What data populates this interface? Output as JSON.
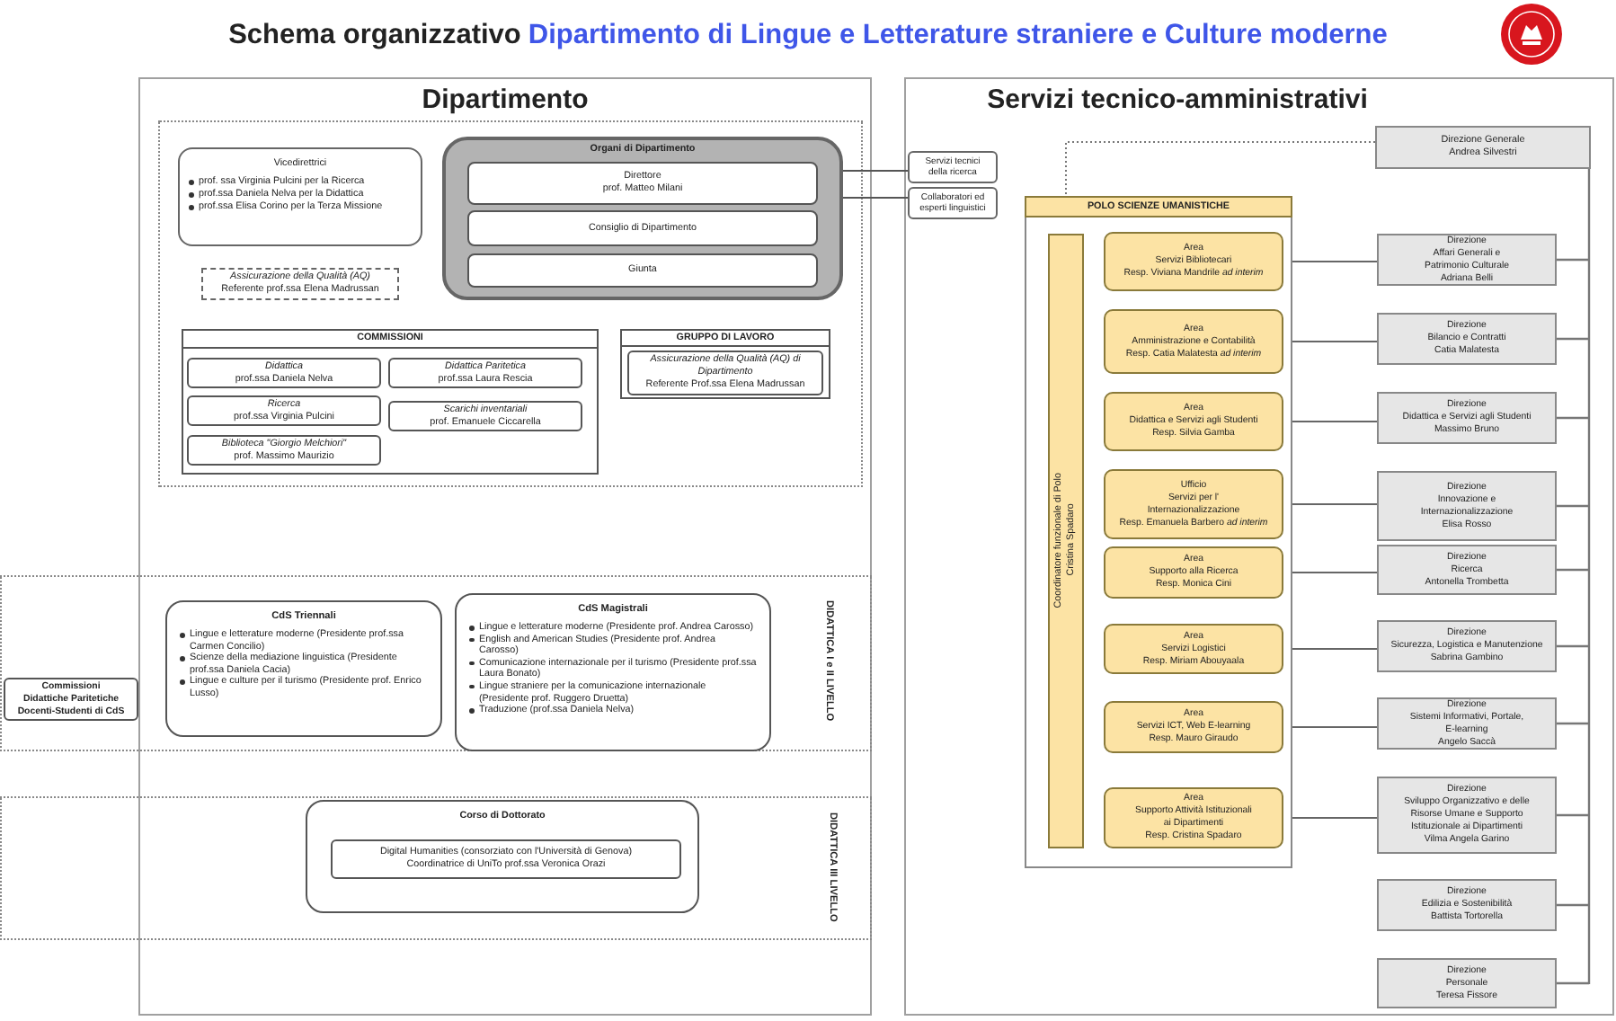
{
  "header": {
    "title": "Schema organizzativo",
    "department": "Dipartimento di Lingue e Letterature straniere e Culture moderne"
  },
  "department": {
    "title": "Dipartimento",
    "vice_directors": {
      "title": "Vicedirettrici",
      "items": [
        "prof. ssa Virginia Pulcini per la Ricerca",
        "prof.ssa Daniela Nelva per la Didattica",
        "prof.ssa Elisa Corino per la Terza Missione"
      ]
    },
    "quality": {
      "name": "Assicurazione della Qualità (AQ)",
      "person": "Referente prof.ssa Elena Madrussan"
    },
    "organs": {
      "title": "Organi di Dipartimento",
      "members": [
        {
          "lines": [
            "Direttore",
            "prof. Matteo Milani"
          ]
        },
        {
          "lines": [
            "Consiglio di Dipartimento"
          ]
        },
        {
          "lines": [
            "Giunta"
          ]
        }
      ]
    },
    "commissions": {
      "title": "COMMISSIONI",
      "items": [
        {
          "name": "Didattica",
          "person": "prof.ssa Daniela Nelva"
        },
        {
          "name": "Didattica Paritetica",
          "person": "prof.ssa Laura Rescia"
        },
        {
          "name": "Ricerca",
          "person": "prof.ssa Virginia Pulcini"
        },
        {
          "name": "Scarichi inventariali",
          "person": "prof. Emanuele Ciccarella"
        },
        {
          "name": "Biblioteca \"Giorgio Melchiori\"",
          "person": "prof. Massimo Maurizio"
        }
      ]
    },
    "working_group": {
      "title": "GRUPPO DI LAVORO",
      "item": {
        "name": "Assicurazione della Qualità (AQ) di Dipartimento",
        "person": "Referente Prof.ssa Elena Madrussan"
      }
    }
  },
  "linked_services": [
    {
      "lines": [
        "Servizi tecnici",
        "della ricerca"
      ]
    },
    {
      "lines": [
        "Collaboratori ed",
        "esperti linguistici"
      ]
    }
  ],
  "teaching_first_second": {
    "label": "DIDATTICA I e II LIVELLO",
    "committee": {
      "lines": [
        "Commissioni",
        "Didattiche Paritetiche",
        "Docenti-Studenti di CdS"
      ]
    },
    "programs": [
      {
        "title": "CdS Triennali",
        "items": [
          "Lingue e letterature moderne (Presidente prof.ssa Carmen Concilio)",
          "Scienze della mediazione linguistica (Presidente prof.ssa Daniela Cacia)",
          "Lingue e culture per il turismo (Presidente prof. Enrico Lusso)"
        ]
      },
      {
        "title": "CdS Magistrali",
        "items": [
          "Lingue e letterature moderne (Presidente prof. Andrea Carosso)",
          "English and American Studies (Presidente prof. Andrea Carosso)",
          "Comunicazione internazionale per il turismo (Presidente prof.ssa Laura Bonato)",
          "Lingue straniere per la comunicazione internazionale (Presidente prof. Ruggero Druetta)",
          "Traduzione (prof.ssa Daniela Nelva)"
        ]
      }
    ]
  },
  "teaching_third": {
    "label": "DIDATTICA III LIVELLO",
    "title": "Corso di Dottorato",
    "item": {
      "lines": [
        "Digital Humanities (consorziato con l'Università di Genova)",
        "Coordinatrice di UniTo prof.ssa Veronica Orazi"
      ]
    }
  },
  "services": {
    "title": "Servizi tecnico-amministrativi",
    "general": {
      "lines": [
        "Direzione Generale",
        "Andrea Silvestri"
      ]
    },
    "pole": {
      "title": "POLO SCIENZE UMANISTICHE",
      "coordinator": {
        "lines": [
          "Coordinatore funzionale di Polo",
          "Cristina Spadaro"
        ]
      },
      "areas": [
        {
          "lines": [
            "Area",
            "Servizi Bibliotecari",
            "Resp. Viviana Mandrile *ad interim*"
          ]
        },
        {
          "lines": [
            "Area",
            "Amministrazione e Contabilità",
            "Resp. Catia Malatesta *ad interim*"
          ]
        },
        {
          "lines": [
            "Area",
            "Didattica e Servizi agli Studenti",
            "Resp. Silvia Gamba"
          ]
        },
        {
          "lines": [
            "Ufficio",
            "Servizi per l'",
            "Internazionalizzazione",
            "Resp. Emanuela Barbero *ad interim*"
          ]
        },
        {
          "lines": [
            "Area",
            "Supporto alla Ricerca",
            "Resp. Monica Cini"
          ]
        },
        {
          "lines": [
            "Area",
            "Servizi Logistici",
            "Resp. Miriam Abouyaala"
          ]
        },
        {
          "lines": [
            "Area",
            "Servizi ICT, Web E-learning",
            "Resp. Mauro Giraudo"
          ]
        },
        {
          "lines": [
            "Area",
            "Supporto Attività Istituzionali",
            "ai Dipartimenti",
            "Resp. Cristina Spadaro"
          ]
        }
      ]
    },
    "directorates": [
      {
        "lines": [
          "Direzione",
          "Affari Generali e",
          "Patrimonio Culturale",
          "Adriana Belli"
        ]
      },
      {
        "lines": [
          "Direzione",
          "Bilancio e Contratti",
          "Catia Malatesta"
        ]
      },
      {
        "lines": [
          "Direzione",
          "Didattica e Servizi agli Studenti",
          "Massimo Bruno"
        ]
      },
      {
        "lines": [
          "Direzione",
          "Innovazione e",
          "Internazionalizzazione",
          "Elisa Rosso"
        ]
      },
      {
        "lines": [
          "Direzione",
          "Ricerca",
          "Antonella Trombetta"
        ]
      },
      {
        "lines": [
          "Direzione",
          "Sicurezza, Logistica e Manutenzione",
          "Sabrina Gambino"
        ]
      },
      {
        "lines": [
          "Direzione",
          "Sistemi Informativi, Portale,",
          "E-learning",
          "Angelo Saccà"
        ]
      },
      {
        "lines": [
          "Direzione",
          "Sviluppo Organizzativo e delle",
          "Risorse Umane e Supporto",
          "Istituzionale ai Dipartimenti",
          "Vilma Angela Garino"
        ]
      },
      {
        "lines": [
          "Direzione",
          "Edilizia e Sostenibilità",
          "Battista Tortorella"
        ]
      },
      {
        "lines": [
          "Direzione",
          "Personale",
          "Teresa Fissore"
        ]
      }
    ]
  }
}
